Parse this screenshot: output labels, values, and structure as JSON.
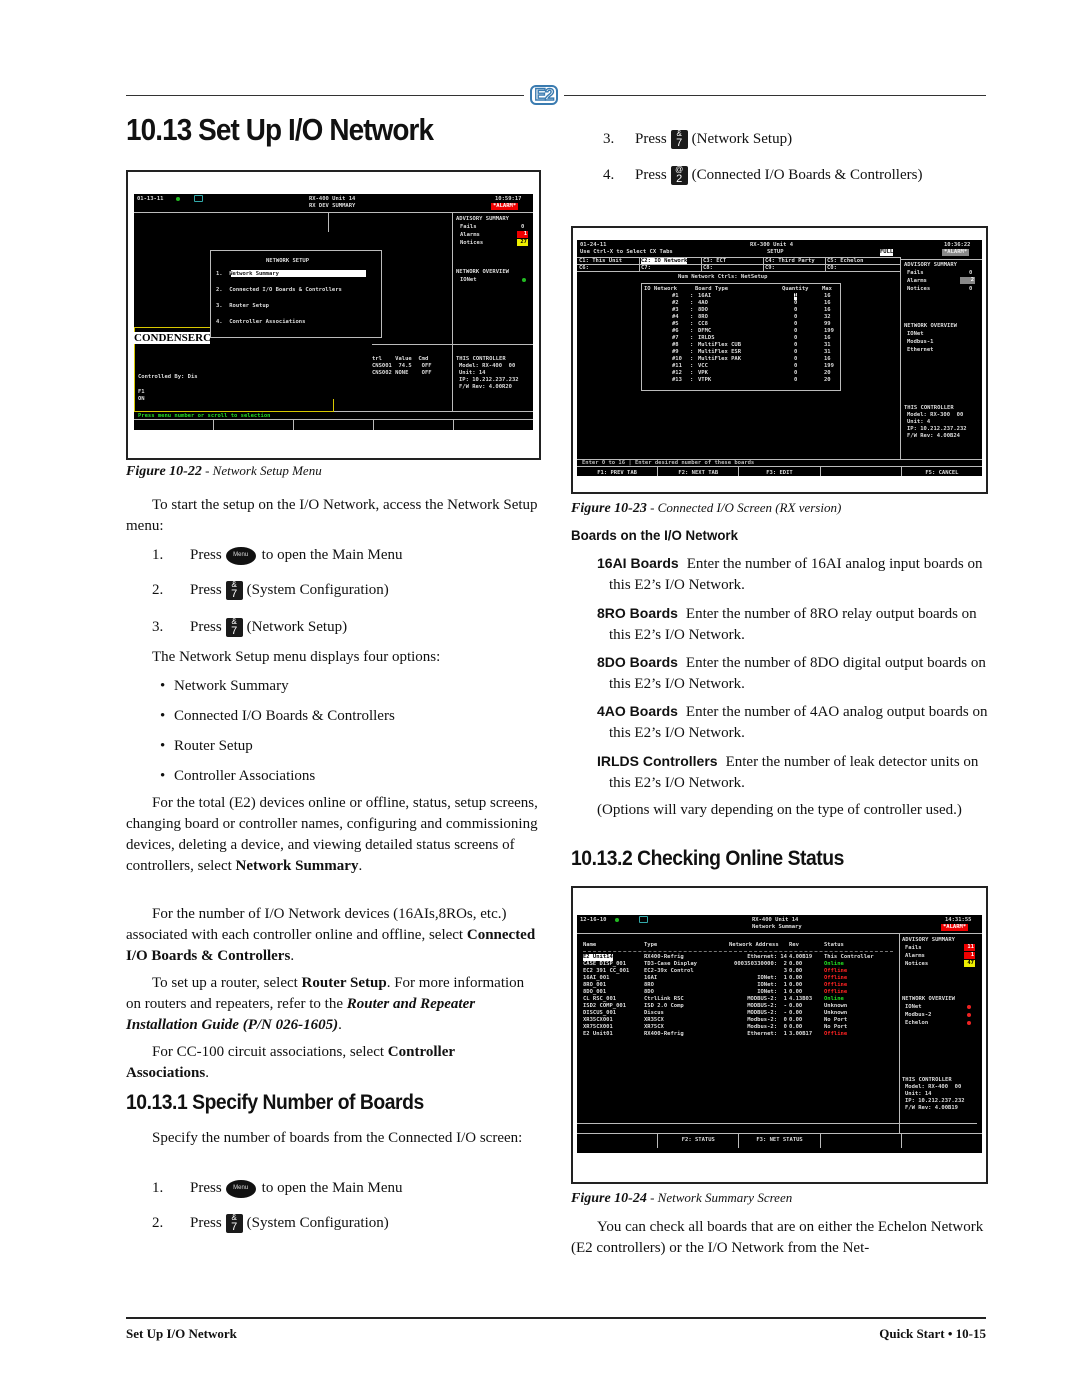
{
  "header": {
    "logo": "E2"
  },
  "title": "10.13 Set Up I/O Network",
  "left": {
    "fig22": {
      "top": {
        "date": "01-13-11",
        "unit": "RX-400 Unit 14",
        "screen": "RX DEV SUMMARY",
        "time": "10:59:17",
        "alarm": "*ALARM*"
      },
      "menu": {
        "title": "NETWORK SETUP",
        "items": [
          "1.  Network Summary",
          "2.  Connected I/O Boards & Controllers",
          "3.  Router Setup",
          "4.  Controller Associations"
        ]
      },
      "advisory": {
        "title": "ADVISORY SUMMARY",
        "fails_label": "Fails",
        "fails": "0",
        "alarms_label": "Alarms",
        "alarms": "1",
        "notices_label": "Notices",
        "notices": "27"
      },
      "network_overview": {
        "title": "NETWORK OVERVIEW",
        "ionet": "IONet"
      },
      "condenser": "CONDENSERC",
      "controlled_by": "Controlled By: Dis",
      "f1": "F1",
      "on": "ON",
      "ctrl_table": {
        "header": "trl    Value  Cmd",
        "row1": "CNS001  74.5   OFF",
        "row2": "CNS002 NONE    OFF"
      },
      "this_controller": {
        "title": "THIS CONTROLLER",
        "model": "Model: RX-400  00",
        "unit": "Unit: 14",
        "ip": "IP: 10.212.237.232",
        "fw": "F/W Rev: 4.00R20"
      },
      "status_line": "Press menu number or scroll to selection",
      "caption_num": "Figure 10-22",
      "caption_text": " - Network Setup Menu"
    },
    "intro": "To start the setup on the I/O Network, access the Network Setup menu:",
    "steps1": [
      {
        "num": "1.",
        "pre": "Press",
        "key": "menu",
        "post": "to open the Main Menu"
      },
      {
        "num": "2.",
        "pre": "Press",
        "key_top": "&",
        "key_bot": "7",
        "post": "(System Configuration)"
      },
      {
        "num": "3.",
        "pre": "Press",
        "key_top": "&",
        "key_bot": "7",
        "post": "(Network Setup)"
      }
    ],
    "menu_intro": "The Network Setup menu displays four options:",
    "bullets": [
      "Network Summary",
      "Connected I/O Boards & Controllers",
      "Router Setup",
      "Controller Associations"
    ],
    "para1": {
      "text": "For the total (E2) devices online or offline, status, setup screens, changing board or controller names, configuring and commissioning devices, deleting a device, and viewing detailed status screens of controllers, select ",
      "bold": "Network Summary",
      "end": "."
    },
    "para2": {
      "text": "For the number of I/O Network devices (16AIs,8ROs, etc.) associated with each controller online and offline, select ",
      "bold": "Connected I/O Boards & Controllers",
      "end": "."
    },
    "para3": {
      "text": "To set up a router, select ",
      "bold": "Router Setup",
      "mid": ". For more information on routers and repeaters, refer to the ",
      "bi": "Router and Repeater Installation Guide (P/N 026-1605)",
      "end": "."
    },
    "para4": {
      "text": "For CC-100 circuit associations, select ",
      "bold": "Controller Associations",
      "end": "."
    },
    "sub1": "10.13.1 Specify Number of Boards",
    "sub1_intro": "Specify the number of boards from the Connected I/O screen:",
    "steps2": [
      {
        "num": "1.",
        "pre": "Press",
        "post": "to open the Main Menu"
      },
      {
        "num": "2.",
        "pre": "Press",
        "key_top": "&",
        "key_bot": "7",
        "post": "(System Configuration)"
      }
    ]
  },
  "right": {
    "steps": [
      {
        "num": "3.",
        "pre": "Press",
        "key_top": "&",
        "key_bot": "7",
        "post": "(Network Setup)"
      },
      {
        "num": "4.",
        "pre": "Press",
        "key_top": "@",
        "key_bot": "2",
        "post": "(Connected I/O Boards & Controllers)"
      }
    ],
    "fig23": {
      "top": {
        "date": "01-24-11",
        "hint": "Use Ctrl-X to Select CX Tabs",
        "unit": "RX-300 Unit 4",
        "screen": "SETUP",
        "full": "FULL",
        "time": "10:36:22",
        "alarm": "*ALARM*"
      },
      "tabs_row1": [
        "C1: This Unit",
        "C2: IO Network",
        "C3: ECT",
        "C4: Third Party",
        "C5: Echelon"
      ],
      "tabs_row2": [
        "C6:",
        "C7:",
        "C8:",
        "C9:",
        "C0:"
      ],
      "subtitle": "Num Network Ctrls: NetSetup",
      "table_header": [
        "IO Network",
        "Board Type",
        "Quantity",
        "Max"
      ],
      "rows": [
        {
          "id": "#1",
          "type": "16AI",
          "qty": "1",
          "max": "16"
        },
        {
          "id": "#2",
          "type": "4AO",
          "qty": "0",
          "max": "16"
        },
        {
          "id": "#3",
          "type": "8DO",
          "qty": "0",
          "max": "16"
        },
        {
          "id": "#4",
          "type": "8RO",
          "qty": "0",
          "max": "32"
        },
        {
          "id": "#5",
          "type": "CC8",
          "qty": "0",
          "max": "99"
        },
        {
          "id": "#6",
          "type": "DFMC",
          "qty": "0",
          "max": "199"
        },
        {
          "id": "#7",
          "type": "IRLDS",
          "qty": "0",
          "max": "16"
        },
        {
          "id": "#8",
          "type": "MultiFlex CUB",
          "qty": "0",
          "max": "31"
        },
        {
          "id": "#9",
          "type": "MultiFlex ESR",
          "qty": "0",
          "max": "31"
        },
        {
          "id": "#10",
          "type": "MultiFlex PAK",
          "qty": "0",
          "max": "16"
        },
        {
          "id": "#11",
          "type": "VCC",
          "qty": "0",
          "max": "199"
        },
        {
          "id": "#12",
          "type": "VPK",
          "qty": "0",
          "max": "20"
        },
        {
          "id": "#13",
          "type": "VTPK",
          "qty": "0",
          "max": "20"
        }
      ],
      "advisory": {
        "title": "ADVISORY SUMMARY",
        "fails_label": "Fails",
        "fails": "0",
        "alarms_label": "Alarms",
        "alarms": "2",
        "notices_label": "Notices",
        "notices": "0"
      },
      "network_overview": {
        "title": "NETWORK OVERVIEW",
        "items": [
          "IONet",
          "Modbus-1",
          "Ethernet"
        ]
      },
      "this_controller": {
        "title": "THIS CONTROLLER",
        "model": "Model: RX-300  00",
        "unit": "Unit: 4",
        "ip": "IP: 10.212.237.232",
        "fw": "F/W Rev: 4.00B24"
      },
      "status_line": "Enter 0 to 16 | Enter desired number of these boards",
      "fkeys": [
        "F1: PREV TAB",
        "F2: NEXT TAB",
        "F3: EDIT",
        "",
        "F5: CANCEL"
      ],
      "caption_num": "Figure 10-23",
      "caption_text": " - Connected I/O Screen (RX version)"
    },
    "boards_heading": "Boards on the I/O Network",
    "terms": [
      {
        "term": "16AI Boards",
        "desc": "Enter the number of 16AI analog input boards on this E2’s I/O Network."
      },
      {
        "term": "8RO Boards",
        "desc": "Enter the number of 8RO relay output boards on this E2’s I/O Network."
      },
      {
        "term": "8DO Boards",
        "desc": "Enter the number of 8DO digital output boards on this E2’s I/O Network."
      },
      {
        "term": "4AO Boards",
        "desc": "Enter the number of 4AO analog output boards on this E2’s I/O Network."
      },
      {
        "term": "IRLDS Controllers",
        "desc": "Enter the number of leak detector units on this E2’s I/O Network."
      }
    ],
    "options_note": "(Options will vary depending on the type of controller used.)",
    "sub2": "10.13.2 Checking Online Status",
    "fig24": {
      "top": {
        "date": "12-16-10",
        "unit": "RX-400 Unit 14",
        "screen": "Network Summary",
        "time": "14:31:55",
        "alarm": "*ALARM*"
      },
      "headers": [
        "Name",
        "Type",
        "Network Address",
        "Rev",
        "Status"
      ],
      "rows": [
        {
          "name": "E2 Unit14",
          "type": "RX400-Refrig",
          "addr": "Ethernet: 14",
          "rev": "4.00B19",
          "status": "This Controller",
          "st": "w"
        },
        {
          "name": "CASE DISP_001",
          "type": "TD3-Case Display",
          "addr": "000350330000:  2",
          "rev": "0.00",
          "status": "Online",
          "st": "g"
        },
        {
          "name": "EC2 391 CC_001",
          "type": "EC2-39x Control",
          "addr": "3",
          "rev": "0.00",
          "status": "Offline",
          "st": "r"
        },
        {
          "name": "16AI_001",
          "type": "16AI",
          "addr": "IONet:  1",
          "rev": "0.00",
          "status": "Offline",
          "st": "r"
        },
        {
          "name": "8RO_001",
          "type": "8RO",
          "addr": "IONet:  1",
          "rev": "0.00",
          "status": "Offline",
          "st": "r"
        },
        {
          "name": "8DO_001",
          "type": "8DO",
          "addr": "IONet:  1",
          "rev": "0.00",
          "status": "Offline",
          "st": "r"
        },
        {
          "name": "CL RSC_001",
          "type": "CtrlLink RSC",
          "addr": "MODBUS-2:  1",
          "rev": "4.13B03",
          "status": "Online",
          "st": "g"
        },
        {
          "name": "ISD2 COMP_001",
          "type": "ISD 2.0 Comp",
          "addr": "MODBUS-2:  -",
          "rev": "0.00",
          "status": "Unknown",
          "st": "w"
        },
        {
          "name": "DISCUS_001",
          "type": "Discus",
          "addr": "MODBUS-2:  -",
          "rev": "0.00",
          "status": "Unknown",
          "st": "w"
        },
        {
          "name": "XR35CX001",
          "type": "XR35CX",
          "addr": "Modbus-2:  0",
          "rev": "0.00",
          "status": "No Port",
          "st": "w"
        },
        {
          "name": "XR75CX001",
          "type": "XR75CX",
          "addr": "Modbus-2:  0",
          "rev": "0.00",
          "status": "No Port",
          "st": "w"
        },
        {
          "name": "E2 Unit01",
          "type": "RX400-Refrig",
          "addr": "Ethernet:  1",
          "rev": "3.00B17",
          "status": "Offline",
          "st": "r"
        }
      ],
      "advisory": {
        "title": "ADVISORY SUMMARY",
        "fails_label": "Fails",
        "fails": "11",
        "alarms_label": "Alarms",
        "alarms": "1",
        "notices_label": "Notices",
        "notices": "47"
      },
      "network_overview": {
        "title": "NETWORK OVERVIEW",
        "items": [
          "IONet",
          "Modbus-2",
          "Echelon"
        ]
      },
      "this_controller": {
        "title": "THIS CONTROLLER",
        "model": "Model: RX-400  00",
        "unit": "Unit: 14",
        "ip": "IP: 10.212.237.232",
        "fw": "F/W Rev: 4.00B19"
      },
      "fkeys": [
        "",
        "F2: STATUS",
        "F3: NET STATUS",
        "",
        ""
      ],
      "caption_num": "Figure 10-24",
      "caption_text": " - Network Summary Screen"
    },
    "closing": "You can check all boards that are on either the Echelon Network (E2 controllers) or the I/O Network from the Net-"
  },
  "footer": {
    "left": "Set Up I/O Network",
    "right": "Quick Start • 10-15"
  },
  "colors": {
    "alarm_red": "#e00000",
    "notice_yellow": "#eeee00",
    "online_green": "#22dd22",
    "logo_blue": "#3a7bb0",
    "highlight_yellow": "#d8c800"
  }
}
